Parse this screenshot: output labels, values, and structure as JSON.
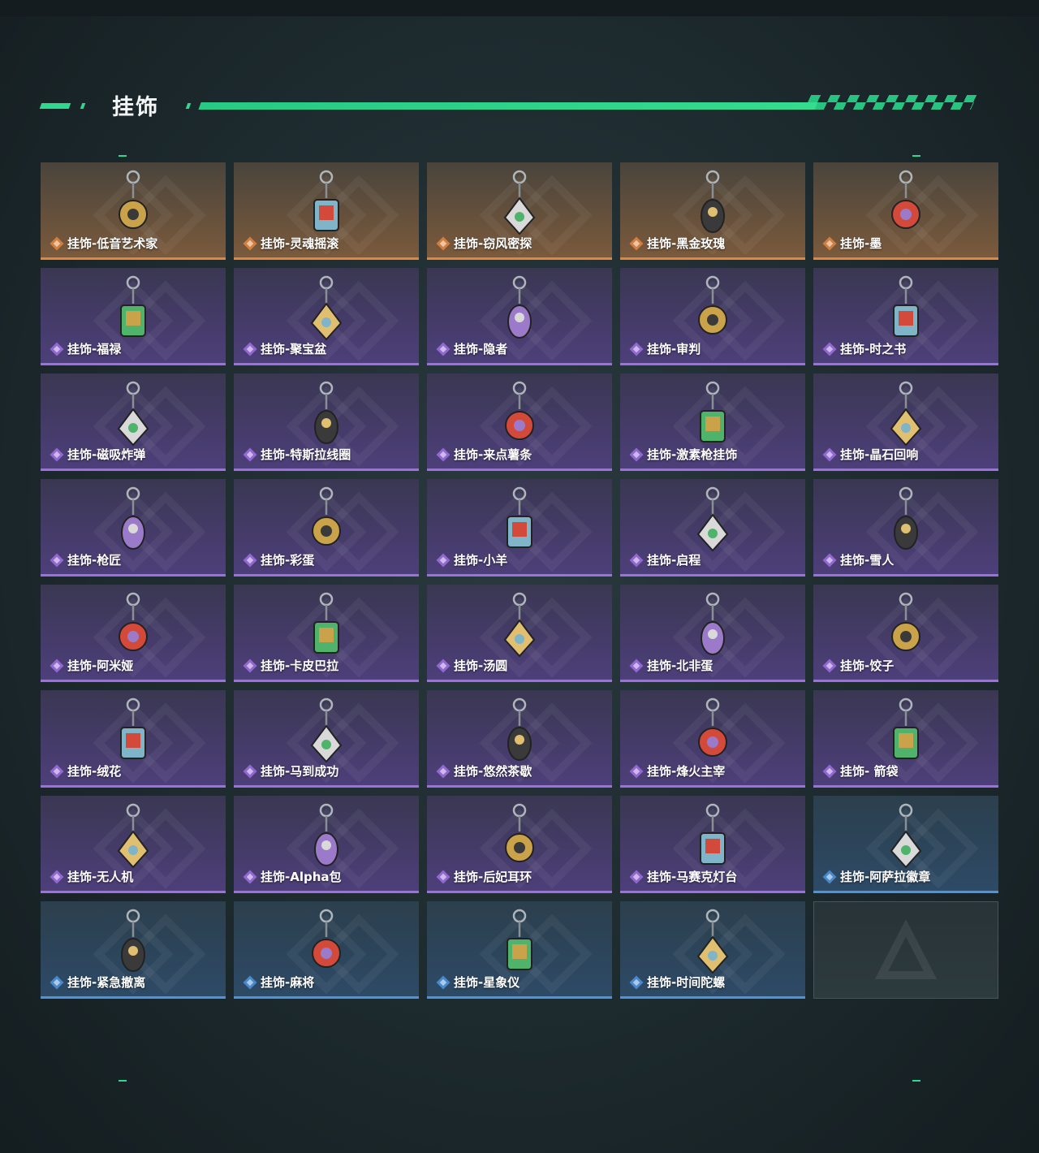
{
  "header": {
    "title": "挂饰"
  },
  "colors": {
    "accent": "#2fd88c",
    "orange": "#e2853f",
    "purple": "#9e6fe0",
    "blue": "#4e93dd"
  },
  "items": [
    {
      "label": "挂饰-低音艺术家",
      "rarity": "orange"
    },
    {
      "label": "挂饰-灵魂摇滚",
      "rarity": "orange"
    },
    {
      "label": "挂饰-窃风密探",
      "rarity": "orange"
    },
    {
      "label": "挂饰-黑金玫瑰",
      "rarity": "orange"
    },
    {
      "label": "挂饰-墨",
      "rarity": "orange"
    },
    {
      "label": "挂饰-福禄",
      "rarity": "purple"
    },
    {
      "label": "挂饰-聚宝盆",
      "rarity": "purple"
    },
    {
      "label": "挂饰-隐者",
      "rarity": "purple"
    },
    {
      "label": "挂饰-审判",
      "rarity": "purple"
    },
    {
      "label": "挂饰-时之书",
      "rarity": "purple"
    },
    {
      "label": "挂饰-磁吸炸弹",
      "rarity": "purple"
    },
    {
      "label": "挂饰-特斯拉线圈",
      "rarity": "purple"
    },
    {
      "label": "挂饰-来点薯条",
      "rarity": "purple"
    },
    {
      "label": "挂饰-激素枪挂饰",
      "rarity": "purple"
    },
    {
      "label": "挂饰-晶石回响",
      "rarity": "purple"
    },
    {
      "label": "挂饰-枪匠",
      "rarity": "purple"
    },
    {
      "label": "挂饰-彩蛋",
      "rarity": "purple"
    },
    {
      "label": "挂饰-小羊",
      "rarity": "purple"
    },
    {
      "label": "挂饰-启程",
      "rarity": "purple"
    },
    {
      "label": "挂饰-雪人",
      "rarity": "purple"
    },
    {
      "label": "挂饰-阿米娅",
      "rarity": "purple"
    },
    {
      "label": "挂饰-卡皮巴拉",
      "rarity": "purple"
    },
    {
      "label": "挂饰-汤圆",
      "rarity": "purple"
    },
    {
      "label": "挂饰-北非蛋",
      "rarity": "purple"
    },
    {
      "label": "挂饰-饺子",
      "rarity": "purple"
    },
    {
      "label": "挂饰-绒花",
      "rarity": "purple"
    },
    {
      "label": "挂饰-马到成功",
      "rarity": "purple"
    },
    {
      "label": "挂饰-悠然茶歇",
      "rarity": "purple"
    },
    {
      "label": "挂饰-烽火主宰",
      "rarity": "purple"
    },
    {
      "label": "挂饰- 箭袋",
      "rarity": "purple"
    },
    {
      "label": "挂饰-无人机",
      "rarity": "purple"
    },
    {
      "label": "挂饰-Alpha包",
      "rarity": "purple"
    },
    {
      "label": "挂饰-后妃耳环",
      "rarity": "purple"
    },
    {
      "label": "挂饰-马赛克灯台",
      "rarity": "purple"
    },
    {
      "label": "挂饰-阿萨拉徽章",
      "rarity": "blue"
    },
    {
      "label": "挂饰-紧急撤离",
      "rarity": "blue"
    },
    {
      "label": "挂饰-麻将",
      "rarity": "blue"
    },
    {
      "label": "挂饰-星象仪",
      "rarity": "blue"
    },
    {
      "label": "挂饰-时间陀螺",
      "rarity": "blue"
    }
  ]
}
